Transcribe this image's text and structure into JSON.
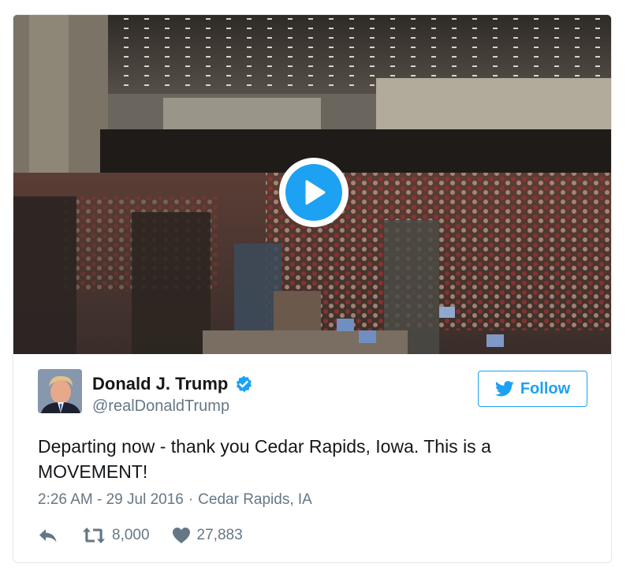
{
  "author": {
    "display_name": "Donald J. Trump",
    "handle": "@realDonaldTrump",
    "verified": true,
    "avatar_icon": "profile-photo"
  },
  "follow_button": {
    "label": "Follow",
    "icon": "twitter-bird-icon"
  },
  "tweet": {
    "text": "Departing now - thank you Cedar Rapids, Iowa. This is a MOVEMENT!",
    "time": "2:26 AM - 29 Jul 2016",
    "location": "Cedar Rapids, IA",
    "separator": "·"
  },
  "actions": {
    "reply_icon": "reply-icon",
    "retweet_icon": "retweet-icon",
    "retweet_count": "8,000",
    "like_icon": "heart-icon",
    "like_count": "27,883"
  },
  "media": {
    "type": "video",
    "play_icon": "play-icon",
    "description_visual_only": true
  },
  "colors": {
    "accent": "#1da1f2",
    "text": "#14171a",
    "muted": "#657786",
    "border": "#e1e8ed"
  }
}
